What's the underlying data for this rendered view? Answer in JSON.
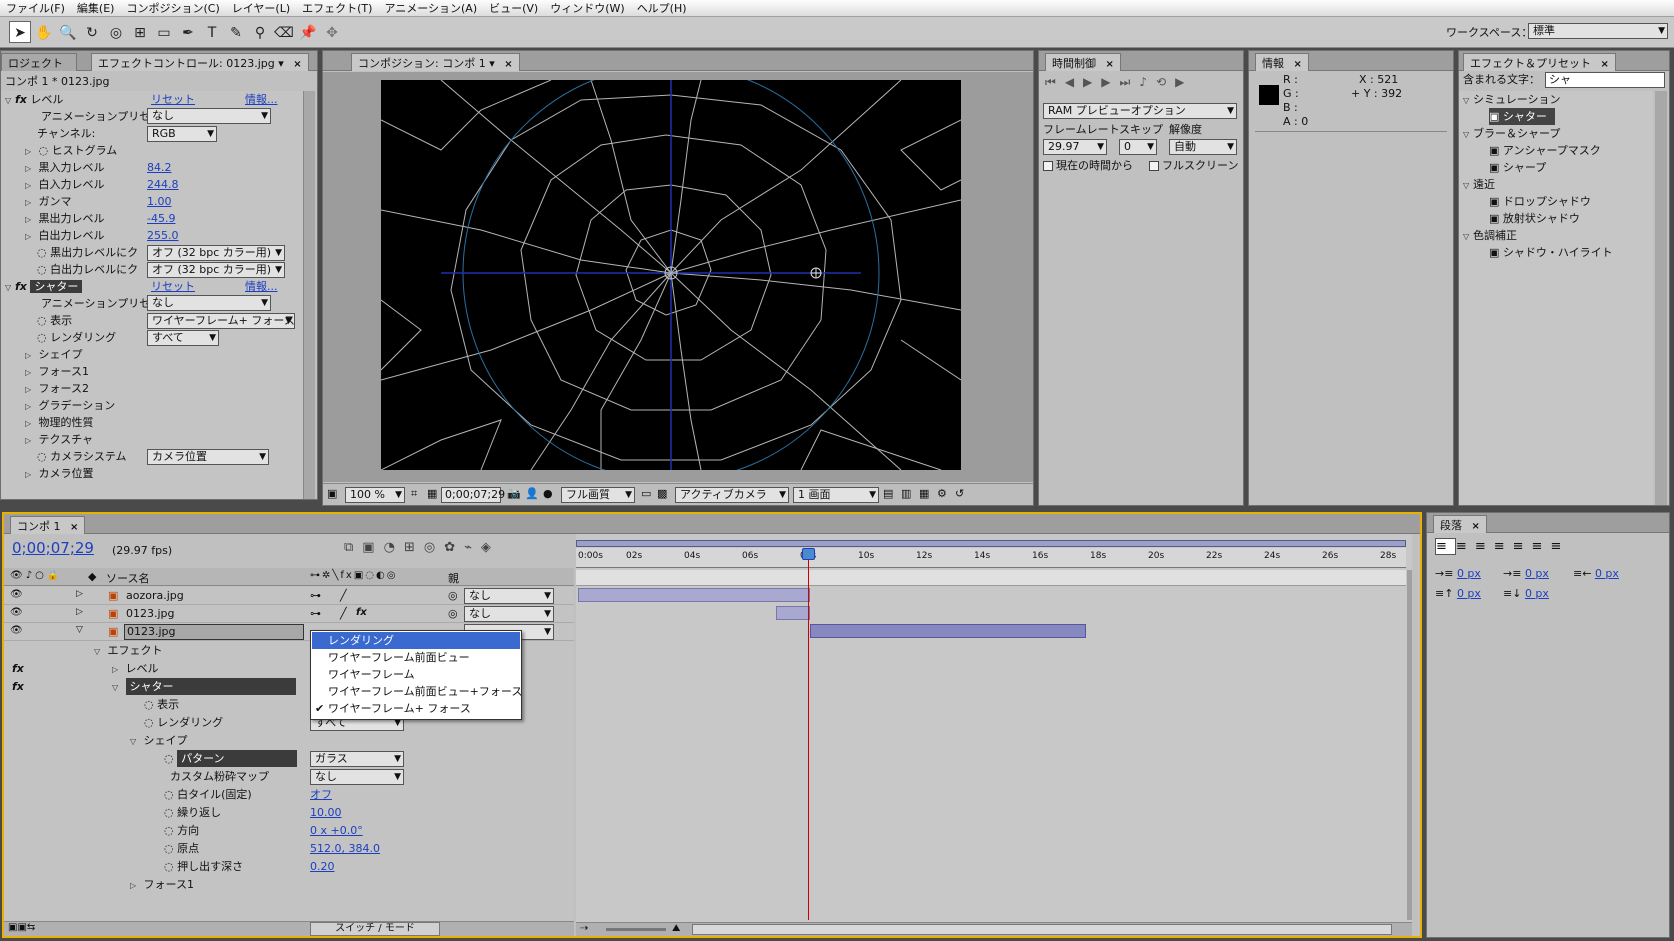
{
  "menu": [
    "ファイル(F)",
    "編集(E)",
    "コンポジション(C)",
    "レイヤー(L)",
    "エフェクト(T)",
    "アニメーション(A)",
    "ビュー(V)",
    "ウィンドウ(W)",
    "ヘルプ(H)"
  ],
  "workspace": {
    "label": "ワークスペース：",
    "value": "標準"
  },
  "effect_controls": {
    "tab_project": "ロジェクト",
    "tab_label": "エフェクトコントロール: 0123.jpg",
    "subtitle": "コンポ 1 * 0123.jpg",
    "reset": "リセット",
    "info": "情報...",
    "level": {
      "name": "レベル",
      "preset_label": "アニメーションプリセット",
      "preset_value": "なし",
      "channel_label": "チャンネル:",
      "channel_value": "RGB",
      "histogram": "ヒストグラム",
      "items": [
        {
          "label": "黒入力レベル",
          "value": "84.2"
        },
        {
          "label": "白入力レベル",
          "value": "244.8"
        },
        {
          "label": "ガンマ",
          "value": "1.00"
        },
        {
          "label": "黒出力レベル",
          "value": "-45.9"
        },
        {
          "label": "白出力レベル",
          "value": "255.0"
        }
      ],
      "clip_black": "黒出力レベルにク",
      "clip_white": "白出力レベルにク",
      "clip_value": "オフ (32 bpc カラー用)"
    },
    "shatter": {
      "name": "シャター",
      "preset_label": "アニメーションプリセット",
      "preset_value": "なし",
      "view_label": "表示",
      "view_value": "ワイヤーフレーム+ フォース",
      "render_label": "レンダリング",
      "render_value": "すべて",
      "groups": [
        "シェイプ",
        "フォース1",
        "フォース2",
        "グラデーション",
        "物理的性質",
        "テクスチャ"
      ],
      "camera_system_label": "カメラシステム",
      "camera_system_value": "カメラ位置",
      "camera_pos": "カメラ位置"
    }
  },
  "composition": {
    "tab": "コンポジション: コンポ 1",
    "zoom": "100 %",
    "timecode": "0;00;07;29",
    "quality": "フル画質",
    "camera": "アクティブカメラ",
    "views": "1 画面"
  },
  "time_control": {
    "tab": "時間制御",
    "ram_preview": "RAM プレビューオプション",
    "framerate_label": "フレームレート",
    "skip_label": "スキップ",
    "resolution_label": "解像度",
    "framerate": "29.97",
    "skip": "0",
    "resolution": "自動",
    "from_current": "現在の時間から",
    "fullscreen": "フルスクリーン"
  },
  "info": {
    "tab": "情報",
    "r": "R :",
    "g": "G :",
    "b": "B :",
    "a": "A : 0",
    "x": "X : 521",
    "y": "+ Y : 392"
  },
  "effects_presets": {
    "tab": "エフェクト＆プリセット",
    "search_label": "含まれる文字：",
    "search_value": "シャ",
    "tree": [
      {
        "cat": "シミュレーション",
        "items": [
          "シャター"
        ]
      },
      {
        "cat": "ブラー＆シャープ",
        "items": [
          "アンシャープマスク",
          "シャープ"
        ]
      },
      {
        "cat": "遠近",
        "items": [
          "ドロップシャドウ",
          "放射状シャドウ"
        ]
      },
      {
        "cat": "色調補正",
        "items": [
          "シャドウ・ハイライト"
        ]
      }
    ]
  },
  "timeline": {
    "tab": "コンポ 1",
    "timecode": "0;00;07;29",
    "fps": "(29.97 fps)",
    "col_source": "ソース名",
    "col_parent": "親",
    "parent_none": "なし",
    "layers": [
      "aozora.jpg",
      "0123.jpg",
      "0123.jpg"
    ],
    "ticks": [
      "0:00s",
      "02s",
      "04s",
      "06s",
      "08s",
      "10s",
      "12s",
      "14s",
      "16s",
      "18s",
      "20s",
      "22s",
      "24s",
      "26s",
      "28s"
    ],
    "tree": {
      "effects": "エフェクト",
      "level": "レベル",
      "shatter": "シャター",
      "view": "表示",
      "render": "レンダリング",
      "render_value": "すべて",
      "shape": "シェイプ",
      "pattern": "パターン",
      "pattern_value": "ガラス",
      "custom_map": "カスタム粉砕マップ",
      "custom_map_value": "なし",
      "white_tile": "白タイル(固定)",
      "white_tile_value": "オフ",
      "repeat": "繰り返し",
      "repeat_value": "10.00",
      "direction": "方向",
      "direction_value": "0 x +0.0°",
      "origin": "原点",
      "origin_value": "512.0, 384.0",
      "extrude": "押し出す深さ",
      "extrude_value": "0.20",
      "force1": "フォース1"
    },
    "switch_mode": "スイッチ / モード",
    "view_dropdown": [
      "レンダリング",
      "ワイヤーフレーム前面ビュー",
      "ワイヤーフレーム",
      "ワイヤーフレーム前面ビュー+フォース",
      "ワイヤーフレーム+ フォース"
    ]
  },
  "paragraph": {
    "tab": "段落",
    "px": "0 px"
  }
}
